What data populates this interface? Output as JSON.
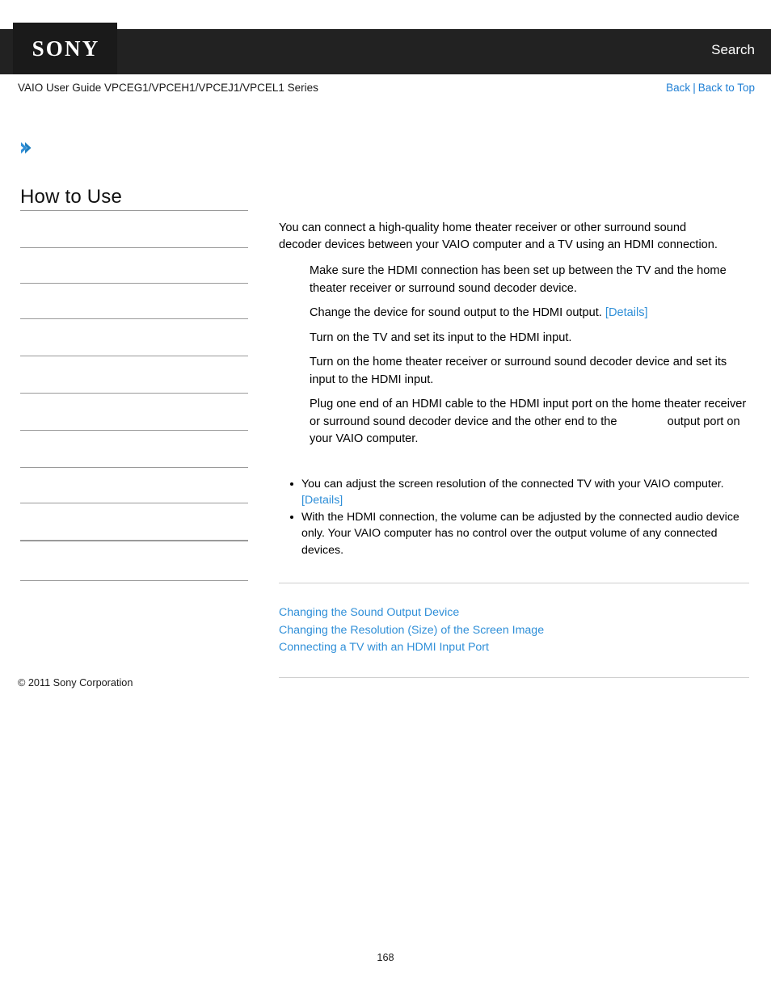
{
  "header": {
    "logo_text": "SONY",
    "search_label": "Search",
    "logo_bg": "#1a1a1a",
    "bar_bg": "#222222"
  },
  "subheader": {
    "guide_title": "VAIO User Guide VPCEG1/VPCEH1/VPCEJ1/VPCEL1 Series",
    "back_label": "Back",
    "separator": "|",
    "back_to_top_label": "Back to Top",
    "link_color": "#1f7fd4"
  },
  "sidebar": {
    "chevron_icon": "double-chevron-right-icon",
    "title": "How to Use",
    "items": [
      {
        "label": ""
      },
      {
        "label": ""
      },
      {
        "label": ""
      },
      {
        "label": ""
      },
      {
        "label": ""
      },
      {
        "label": ""
      },
      {
        "label": ""
      },
      {
        "label": ""
      },
      {
        "label": ""
      },
      {
        "label": ""
      }
    ]
  },
  "main": {
    "intro": "You can connect a high-quality home theater receiver or other surround sound decoder devices between your VAIO computer and a TV using an HDMI connection.",
    "steps": [
      {
        "text": "Make sure the HDMI connection has been set up between the TV and the home theater receiver or surround sound decoder device."
      },
      {
        "text": "Change the device for sound output to the HDMI output. ",
        "link": "[Details]"
      },
      {
        "text": "Turn on the TV and set its input to the HDMI input."
      },
      {
        "text": "Turn on the home theater receiver or surround sound decoder device and set its input to the HDMI input."
      },
      {
        "text_before": "Plug one end of an HDMI cable to the HDMI input port on the home theater receiver or surround sound decoder device and the other end to the ",
        "text_after": "output port on your VAIO computer."
      }
    ],
    "notes": [
      {
        "text": "You can adjust the screen resolution of the connected TV with your VAIO computer. ",
        "link": "[Details]"
      },
      {
        "text": "With the HDMI connection, the volume can be adjusted by the connected audio device only. Your VAIO computer has no control over the output volume of any connected devices."
      }
    ],
    "related_topics": [
      {
        "label": "Changing the Sound Output Device"
      },
      {
        "label": "Changing the Resolution (Size) of the Screen Image"
      },
      {
        "label": "Connecting a TV with an HDMI Input Port"
      }
    ],
    "link_color": "#2f8fd8"
  },
  "footer": {
    "copyright": "© 2011 Sony Corporation",
    "page_number": "168"
  }
}
